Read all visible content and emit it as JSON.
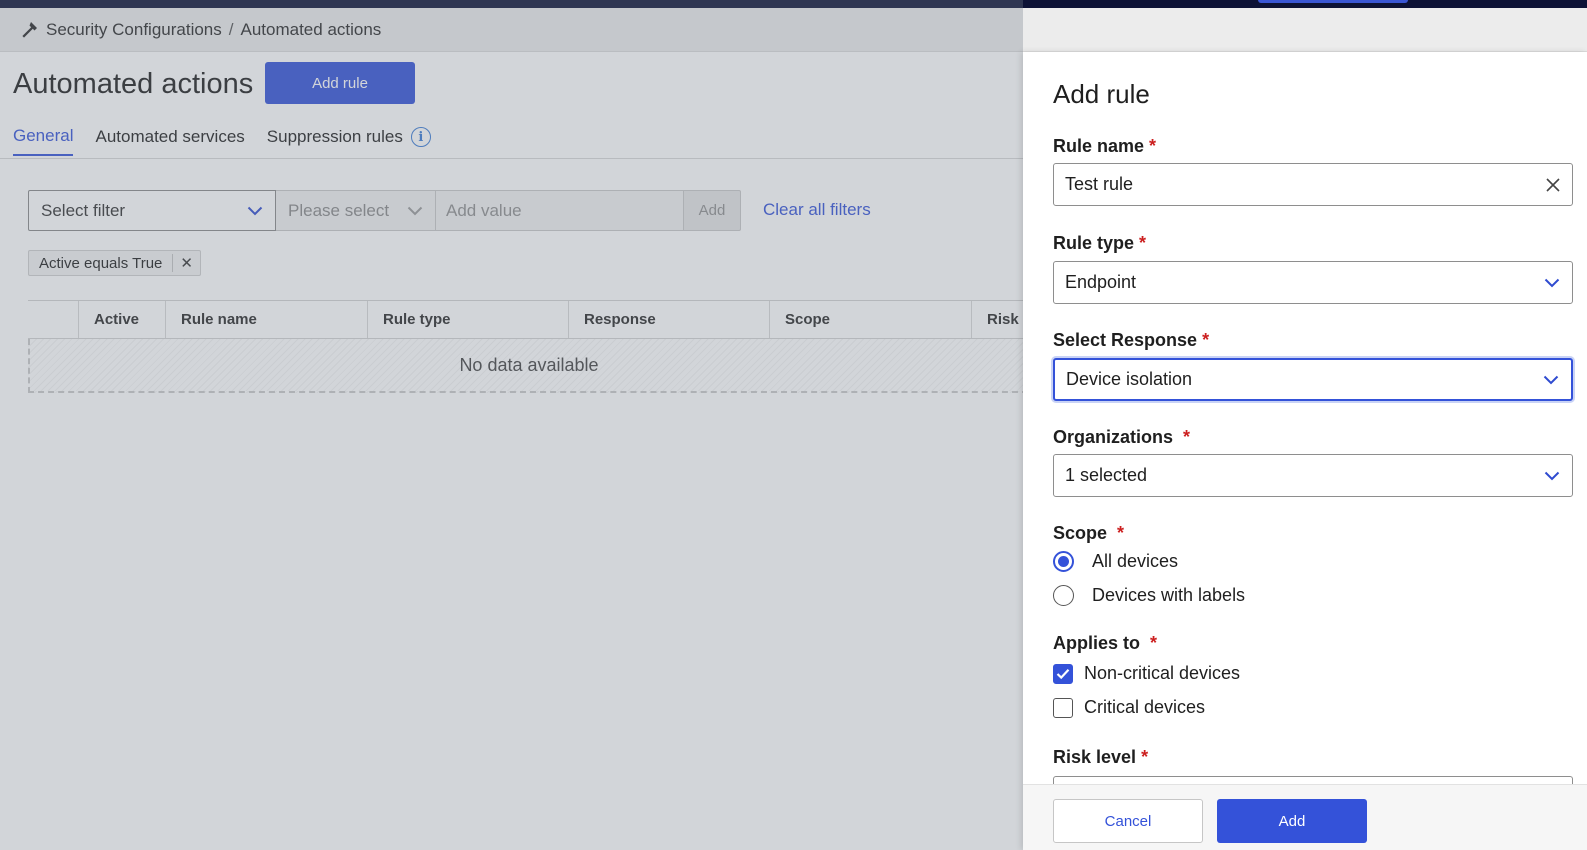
{
  "breadcrumb": {
    "parent": "Security Configurations",
    "separator": "/",
    "current": "Automated actions"
  },
  "page": {
    "title": "Automated actions",
    "add_rule_label": "Add rule"
  },
  "tabs": [
    {
      "label": "General",
      "active": true
    },
    {
      "label": "Automated services",
      "active": false
    },
    {
      "label": "Suppression rules",
      "active": false
    }
  ],
  "filters": {
    "select_filter": "Select filter",
    "operator_placeholder": "Please select",
    "value_placeholder": "Add value",
    "add_label": "Add",
    "clear_all": "Clear all filters",
    "active_chip": "Active equals True"
  },
  "table": {
    "columns": [
      "",
      "Active",
      "Rule name",
      "Rule type",
      "Response",
      "Scope",
      "Risk"
    ],
    "empty_text": "No data available"
  },
  "drawer": {
    "title": "Add rule",
    "required_mark": "*",
    "rule_name": {
      "label": "Rule name",
      "value": "Test rule"
    },
    "rule_type": {
      "label": "Rule type",
      "value": "Endpoint"
    },
    "response": {
      "label": "Select Response",
      "value": "Device isolation"
    },
    "organizations": {
      "label": "Organizations",
      "value": "1 selected"
    },
    "scope": {
      "label": "Scope",
      "options": [
        {
          "label": "All devices",
          "selected": true
        },
        {
          "label": "Devices with labels",
          "selected": false
        }
      ]
    },
    "applies_to": {
      "label": "Applies to",
      "options": [
        {
          "label": "Non-critical devices",
          "checked": true
        },
        {
          "label": "Critical devices",
          "checked": false
        }
      ]
    },
    "risk_level": {
      "label": "Risk level"
    },
    "cancel_label": "Cancel",
    "add_label": "Add"
  },
  "colors": {
    "accent": "#3452d9",
    "required": "#cc1f1f",
    "topbar": "#0d1236"
  },
  "icons": [
    "hammer-icon",
    "info-icon",
    "chevron-down-icon",
    "close-icon",
    "checkmark-icon"
  ]
}
